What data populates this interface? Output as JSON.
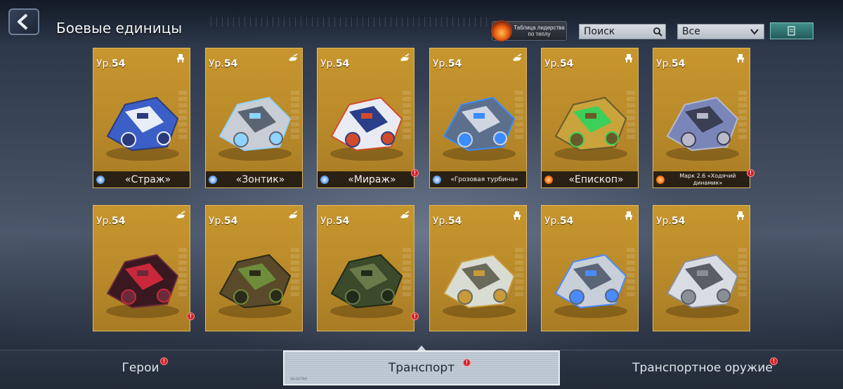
{
  "header": {
    "title": "Боевые единицы",
    "leaderboard_label": "Таблица лидерства по теплу",
    "search_placeholder": "Поиск",
    "filter_value": "Все"
  },
  "level_prefix": "Ур.",
  "units_row1": [
    {
      "level": "54",
      "name": "«Страж»",
      "element": "lightning",
      "type": "mech",
      "alert": false
    },
    {
      "level": "54",
      "name": "«Зонтик»",
      "element": "lightning",
      "type": "vehicle",
      "alert": false
    },
    {
      "level": "54",
      "name": "«Мираж»",
      "element": "lightning",
      "type": "vehicle",
      "alert": true
    },
    {
      "level": "54",
      "name": "«Грозовая турбина»",
      "element": "lightning",
      "type": "vehicle",
      "alert": false
    },
    {
      "level": "54",
      "name": "«Епископ»",
      "element": "fire",
      "type": "mech",
      "alert": false
    },
    {
      "level": "54",
      "name": "Марк 2.6 «Ходячий динамик»",
      "element": "fire",
      "type": "mech",
      "alert": true
    }
  ],
  "units_row2": [
    {
      "level": "54",
      "type": "vehicle",
      "alert": true
    },
    {
      "level": "54",
      "type": "vehicle",
      "alert": false
    },
    {
      "level": "54",
      "type": "vehicle",
      "alert": true
    },
    {
      "level": "54",
      "type": "mech",
      "alert": false
    },
    {
      "level": "54",
      "type": "mech",
      "alert": false
    },
    {
      "level": "54",
      "type": "mech",
      "alert": false
    }
  ],
  "tabs": [
    {
      "label": "Герои",
      "active": false,
      "alert": true
    },
    {
      "label": "Транспорт",
      "active": true,
      "alert": true
    },
    {
      "label": "Транспортное оружие",
      "active": false,
      "alert": true
    }
  ],
  "colors": {
    "card_gold": "#c7962e",
    "alert_red": "#d6202a",
    "lightning_blue": "#7ab8ff",
    "fire_orange": "#ff8a2a"
  }
}
